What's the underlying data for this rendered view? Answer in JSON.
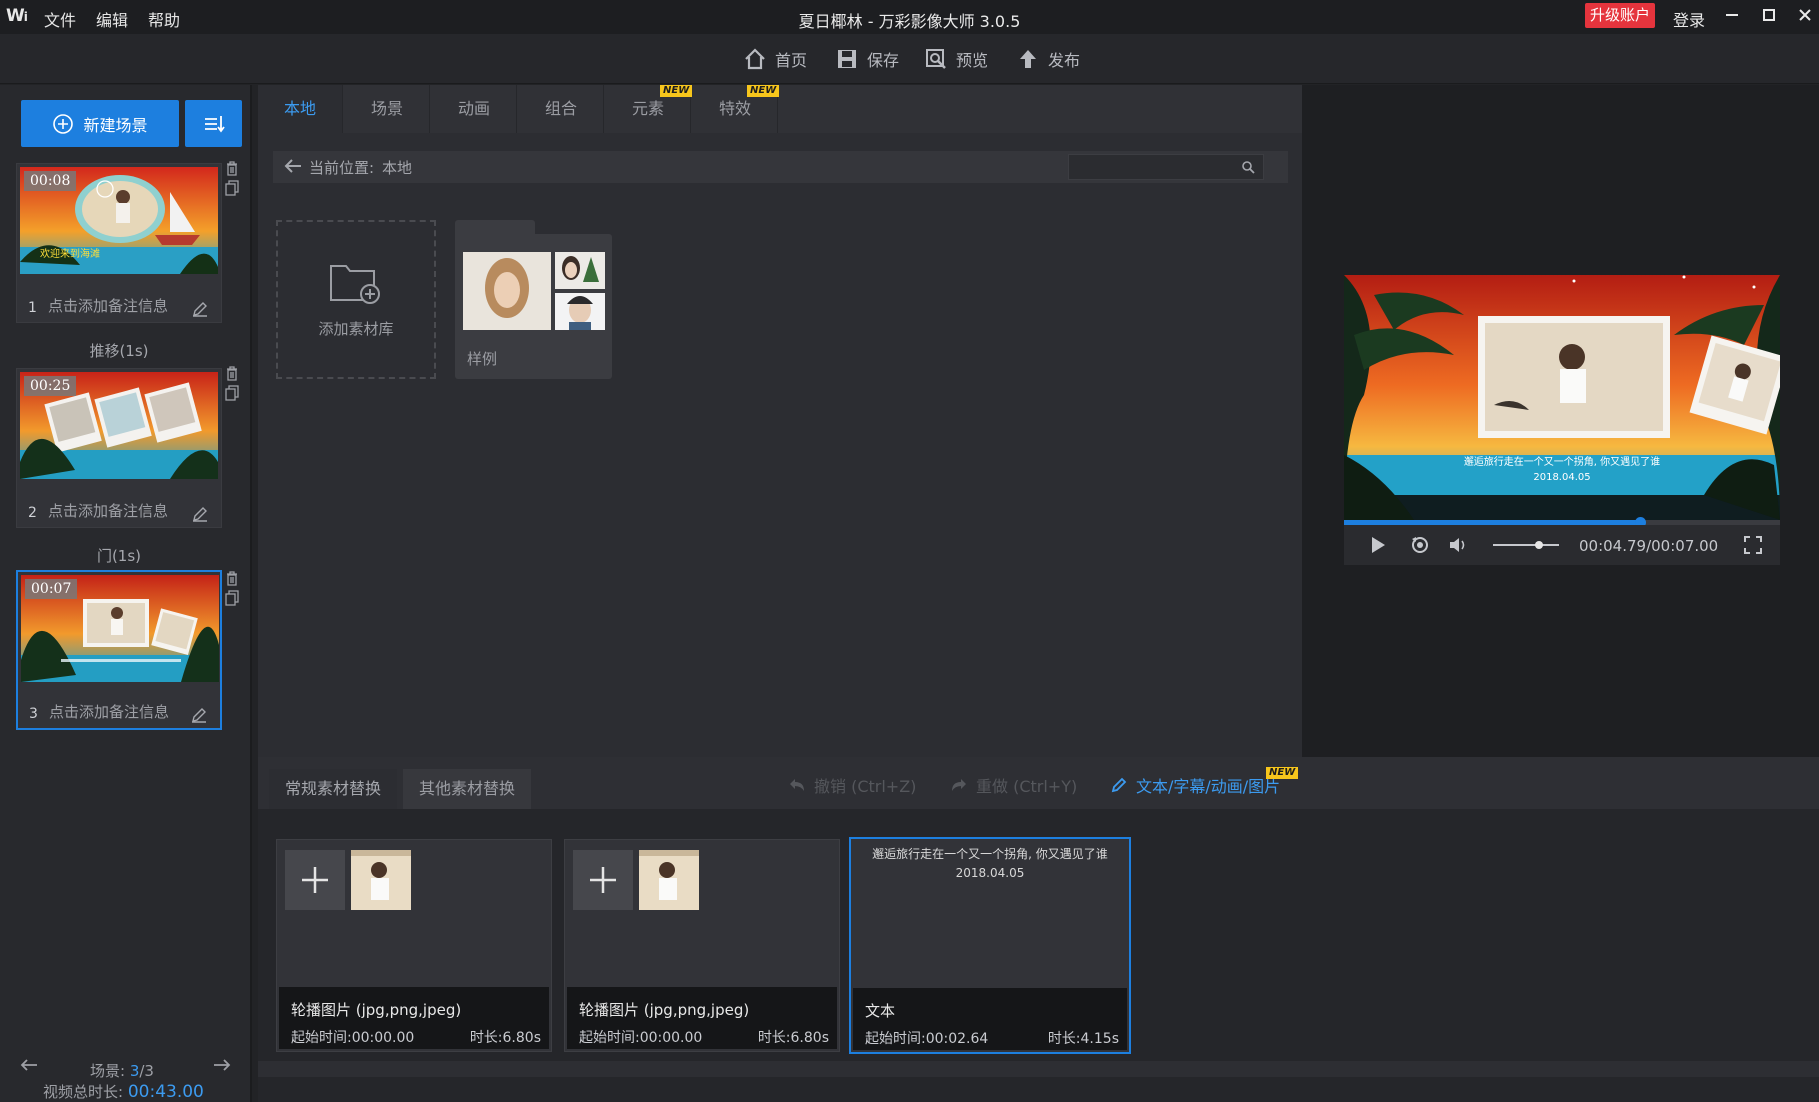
{
  "titlebar": {
    "logo": "W",
    "menu": [
      "文件",
      "编辑",
      "帮助"
    ],
    "title": "夏日椰林 - 万彩影像大师 3.0.5",
    "upgrade": "升级账户",
    "login": "登录"
  },
  "toolbar": {
    "home": "首页",
    "save": "保存",
    "preview": "预览",
    "publish": "发布"
  },
  "left": {
    "new_scene": "新建场景",
    "scenes": [
      {
        "time": "00:08",
        "num": "1",
        "note": "点击添加备注信息"
      },
      {
        "time": "00:25",
        "num": "2",
        "note": "点击添加备注信息"
      },
      {
        "time": "00:07",
        "num": "3",
        "note": "点击添加备注信息"
      }
    ],
    "transitions": [
      "推移(1s)",
      "门(1s)"
    ],
    "scene_counter_label": "场景: ",
    "scene_counter_current": "3",
    "scene_counter_total": "/3",
    "total_label": "视频总时长: ",
    "total_value": "00:43.00"
  },
  "library": {
    "tabs": [
      "本地",
      "场景",
      "动画",
      "组合",
      "元素",
      "特效"
    ],
    "new_badge": "NEW",
    "path_label": "当前位置:",
    "path_value": "本地",
    "search_placeholder": "",
    "add_library": "添加素材库",
    "sample_folder": "样例"
  },
  "preview": {
    "time": "00:04.79/00:07.00",
    "progress": 0.68,
    "volume": 0.7,
    "video_caption": "邂逅旅行走在一个又一个拐角, 你又遇见了谁",
    "video_date": "2018.04.05"
  },
  "bottom": {
    "tabs": [
      "常规素材替换",
      "其他素材替换"
    ],
    "undo": "撤销 (Ctrl+Z)",
    "redo": "重做 (Ctrl+Y)",
    "text_link": "文本/字幕/动画/图片",
    "assets": [
      {
        "name": "轮播图片 (jpg,png,jpeg)",
        "start": "起始时间:00:00.00",
        "duration": "时长:6.80s"
      },
      {
        "name": "轮播图片 (jpg,png,jpeg)",
        "start": "起始时间:00:00.00",
        "duration": "时长:6.80s"
      },
      {
        "name": "文本",
        "start": "起始时间:00:02.64",
        "duration": "时长:4.15s",
        "text_line1": "邂逅旅行走在一个又一个拐角, 你又遇见了谁",
        "text_line2": "2018.04.05"
      }
    ]
  },
  "colors": {
    "accent": "#1d7fdf",
    "upgrade": "#e5343d",
    "badge": "#f7c61c"
  }
}
